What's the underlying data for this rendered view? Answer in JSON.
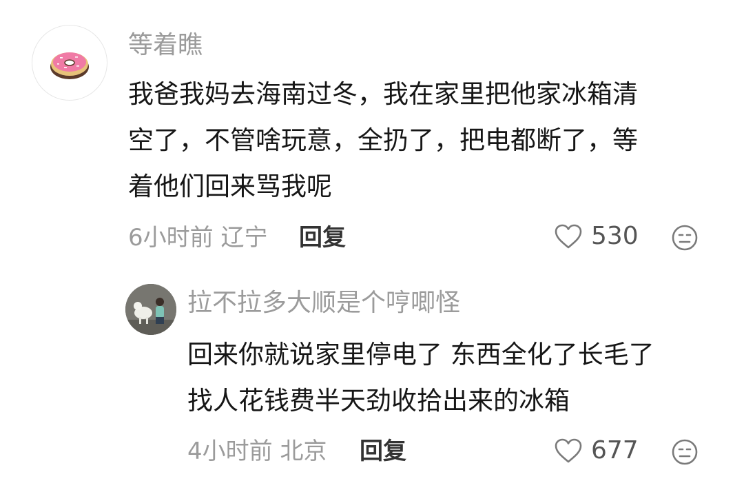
{
  "comments": [
    {
      "username": "等着瞧",
      "text_lines": [
        "我爸我妈去海南过冬，我在家里把他家冰箱清",
        "空了，不管啥玩意，全扔了，把电都断了，等",
        "着他们回来骂我呢"
      ],
      "time_location": "6小时前 辽宁",
      "reply_label": "回复",
      "likes": "530",
      "avatar": "donut-avatar",
      "avatar_colors": {
        "frosting": "#f07aa5",
        "dough": "#e7c27a"
      }
    },
    {
      "username": "拉不拉多大顺是个哼唧怪",
      "text_lines": [
        "回来你就说家里停电了 东西全化了长毛了",
        "找人花钱费半天劲收拾出来的冰箱"
      ],
      "time_location": "4小时前 北京",
      "reply_label": "回复",
      "likes": "677",
      "avatar": "dog-child-photo-avatar"
    }
  ],
  "icons": {
    "like": "heart-outline-icon",
    "dislike": "meh-face-icon"
  }
}
